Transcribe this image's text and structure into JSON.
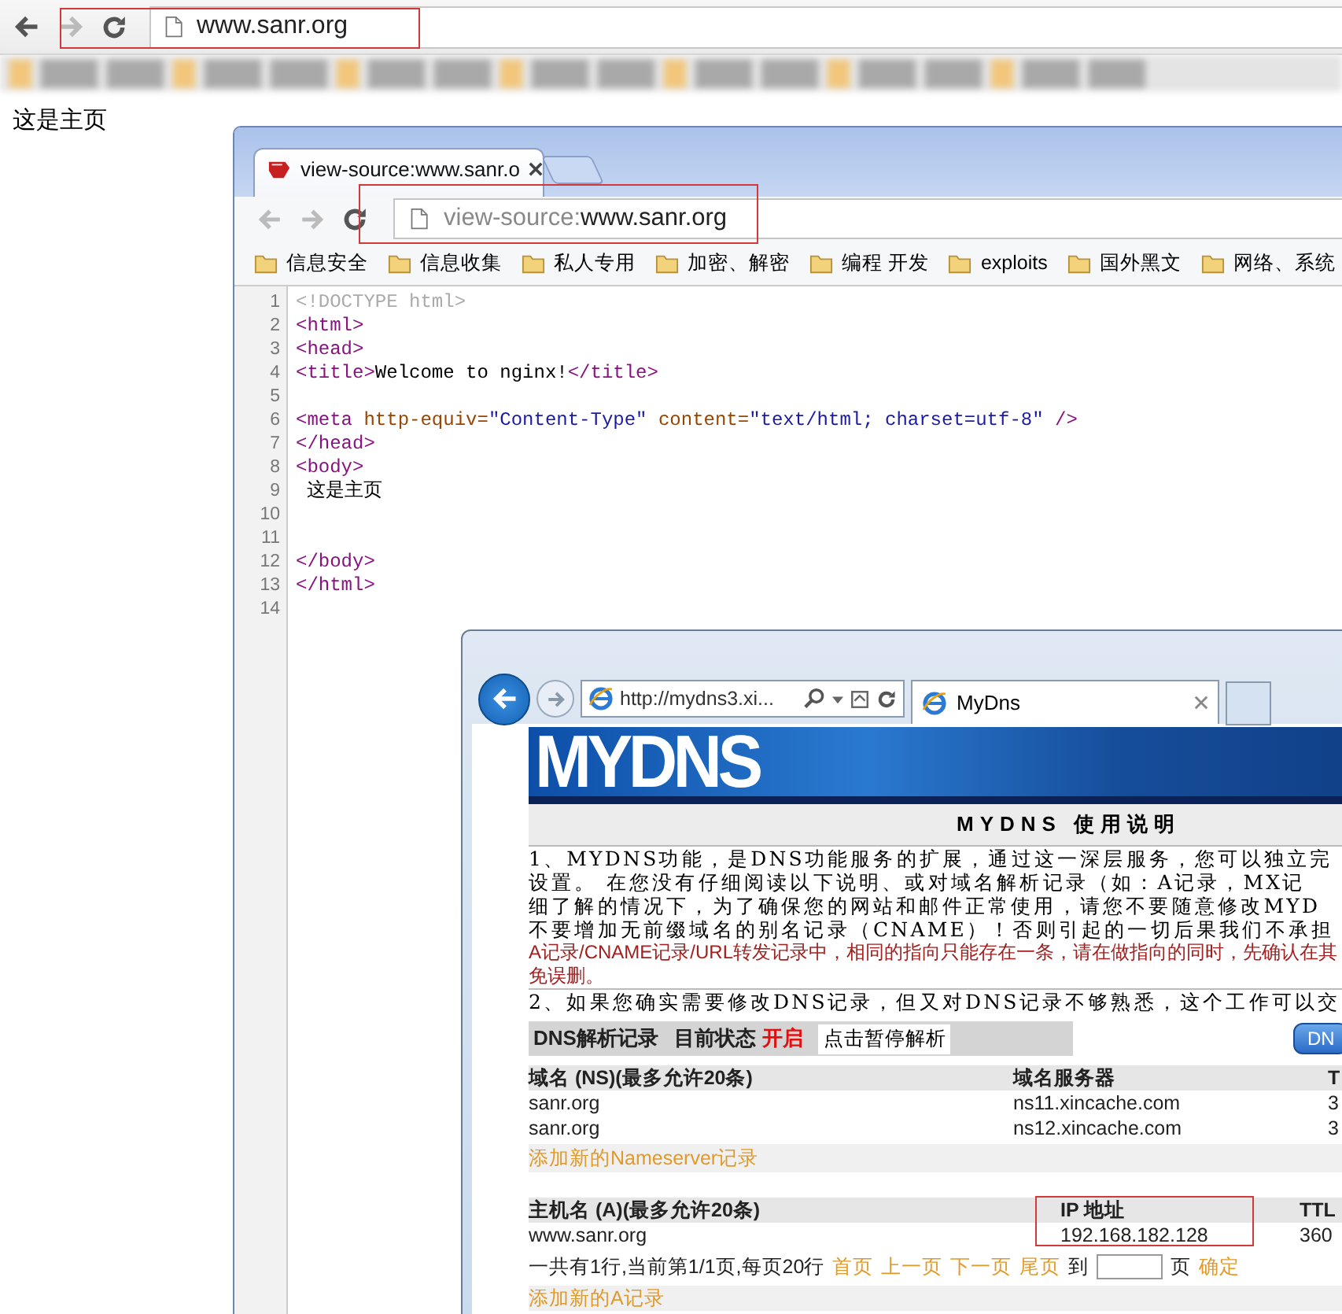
{
  "browser": {
    "url": "www.sanr.org"
  },
  "page": {
    "text": "这是主页"
  },
  "source_window": {
    "tab_title": "view-source:www.sanr.o",
    "url_prefix": "view-source:",
    "url": "www.sanr.org",
    "bookmarks": [
      "信息安全",
      "信息收集",
      "私人专用",
      "加密、解密",
      "编程 开发",
      "exploits",
      "国外黑文",
      "网络、系统"
    ],
    "lines": [
      {
        "number": "1",
        "parts": [
          {
            "kind": "doctype",
            "text": "<!DOCTYPE html>"
          }
        ]
      },
      {
        "number": "2",
        "parts": [
          {
            "kind": "tag",
            "text": "<html>"
          }
        ]
      },
      {
        "number": "3",
        "parts": [
          {
            "kind": "tag",
            "text": "<head>"
          }
        ]
      },
      {
        "number": "4",
        "parts": [
          {
            "kind": "tag",
            "text": "<title>"
          },
          {
            "kind": "text",
            "text": "Welcome to nginx!"
          },
          {
            "kind": "tag",
            "text": "</title>"
          }
        ]
      },
      {
        "number": "5"
      },
      {
        "number": "6",
        "parts": [
          {
            "kind": "tag",
            "text": "<meta"
          },
          {
            "kind": "attr",
            "text": " http-equiv="
          },
          {
            "kind": "value",
            "text": "\"Content-Type\""
          },
          {
            "kind": "attr",
            "text": " content="
          },
          {
            "kind": "value",
            "text": "\"text/html; charset=utf-8\""
          },
          {
            "kind": "tag",
            "text": " />"
          }
        ]
      },
      {
        "number": "7",
        "parts": [
          {
            "kind": "tag",
            "text": "</head>"
          }
        ]
      },
      {
        "number": "8",
        "parts": [
          {
            "kind": "tag",
            "text": "<body>"
          }
        ]
      },
      {
        "number": "9",
        "parts": [
          {
            "kind": "text",
            "text": " 这是主页"
          }
        ]
      },
      {
        "number": "10"
      },
      {
        "number": "11"
      },
      {
        "number": "12",
        "parts": [
          {
            "kind": "tag",
            "text": "</body>"
          }
        ]
      },
      {
        "number": "13",
        "parts": [
          {
            "kind": "tag",
            "text": "</html>"
          }
        ]
      },
      {
        "number": "14"
      }
    ]
  },
  "ie_window": {
    "address": "http://mydns3.xi...",
    "tab_title": "MyDns",
    "logo": "MYDNS",
    "heading": "MYDNS 使用说明",
    "paragraph": [
      {
        "kind": "normal",
        "text": "1、MYDNS功能，是DNS功能服务的扩展，通过这一深层服务，您可以独立完"
      },
      {
        "kind": "normal",
        "text": "设置。 在您没有仔细阅读以下说明、或对域名解析记录（如：A记录，MX记"
      },
      {
        "kind": "normal",
        "text": "细了解的情况下，为了确保您的网站和邮件正常使用，请您不要随意修改MYD"
      },
      {
        "kind": "normal",
        "text": "不要增加无前缀域名的别名记录（CNAME）！否则引起的一切后果我们不承担"
      },
      {
        "kind": "warning",
        "text": "A记录/CNAME记录/URL转发记录中，相同的指向只能存在一条，请在做指向的同时，先确认在其"
      },
      {
        "kind": "warning",
        "text": "免误删。"
      },
      {
        "kind": "normal",
        "text": "2、如果您确实需要修改DNS记录，但又对DNS记录不够熟悉，这个工作可以交"
      }
    ],
    "dns": {
      "title": "DNS解析记录",
      "status_label": "目前状态",
      "status": "开启",
      "toggle_button": "点击暂停解析",
      "side_button": "DN",
      "ns_table": {
        "columns": [
          "域名 (NS)(最多允许20条)",
          "域名服务器",
          "T"
        ],
        "rows": [
          [
            "sanr.org",
            "ns11.xincache.com",
            "3"
          ],
          [
            "sanr.org",
            "ns12.xincache.com",
            "3"
          ]
        ],
        "add_link": "添加新的Nameserver记录"
      },
      "a_table": {
        "columns": [
          "主机名 (A)(最多允许20条)",
          "IP 地址",
          "TTL"
        ],
        "rows": [
          [
            "www.sanr.org",
            "192.168.182.128",
            "360"
          ]
        ]
      },
      "pagination": {
        "summary": "一共有1行,当前第1/1页,每页20行",
        "links": [
          "首页",
          "上一页",
          "下一页",
          "尾页"
        ],
        "goto_label": "到",
        "page_label": "页",
        "confirm": "确定"
      },
      "add_a_link": "添加新的A记录"
    }
  }
}
